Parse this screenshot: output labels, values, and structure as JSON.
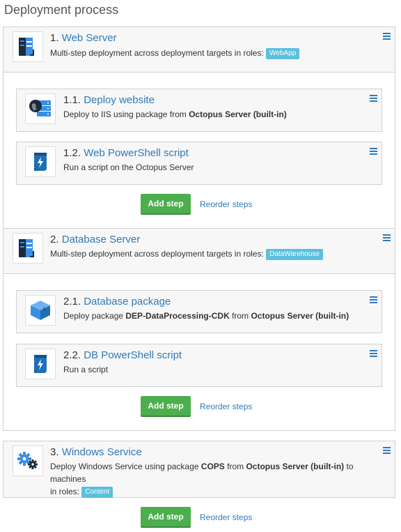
{
  "page_title": "Deployment process",
  "steps": [
    {
      "number": "1.",
      "name": "Web Server",
      "description": "Multi-step deployment across deployment targets in roles:",
      "role": "WebApp",
      "icon": "server-icon",
      "children": [
        {
          "number": "1.1.",
          "name": "Deploy website",
          "desc_prefix": "Deploy to IIS using package from ",
          "desc_bold": "Octopus Server (built-in)",
          "icon": "globe-server-icon"
        },
        {
          "number": "1.2.",
          "name": "Web PowerShell script",
          "desc_prefix": "Run a script on the Octopus Server",
          "icon": "script-icon"
        }
      ]
    },
    {
      "number": "2.",
      "name": "Database Server",
      "description": "Multi-step deployment across deployment targets in roles:",
      "role": "DataWarehouse",
      "icon": "server-icon",
      "children": [
        {
          "number": "2.1.",
          "name": "Database package",
          "desc_prefix": "Deploy package ",
          "desc_bold": "DEP-DataProcessing-CDK",
          "desc_mid": " from ",
          "desc_bold2": "Octopus Server (built-in)",
          "icon": "package-icon"
        },
        {
          "number": "2.2.",
          "name": "DB PowerShell script",
          "desc_prefix": "Run a script",
          "icon": "script-icon"
        }
      ]
    },
    {
      "number": "3.",
      "name": "Windows Service",
      "desc_prefix": "Deploy Windows Service using package ",
      "desc_bold": "COPS",
      "desc_mid": " from ",
      "desc_bold2": "Octopus Server (built-in)",
      "desc_suffix": " to machines",
      "desc_line2": "in roles:",
      "role": "Content",
      "icon": "gears-icon"
    }
  ],
  "actions": {
    "add_step": "Add step",
    "reorder_steps": "Reorder steps"
  },
  "colors": {
    "link": "#2f7ab9",
    "badge": "#5bc0de",
    "add_button": "#4cae4c"
  }
}
